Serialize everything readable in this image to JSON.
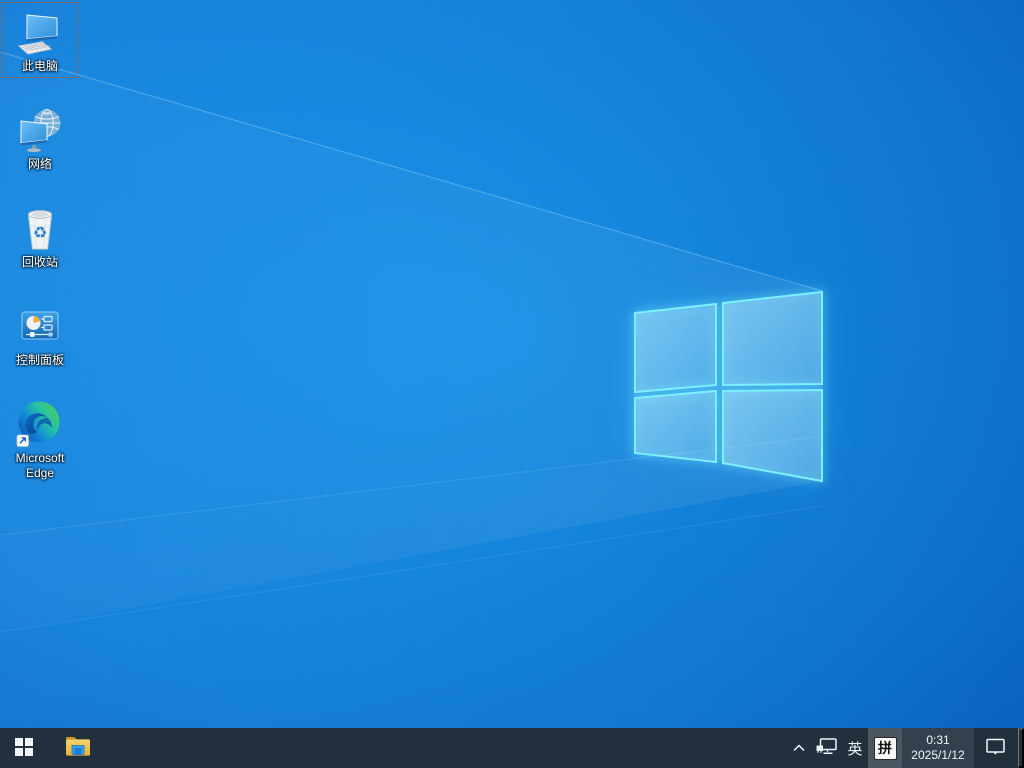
{
  "desktop": {
    "icons": [
      {
        "label": "此电脑",
        "selected": true,
        "icon": "computer-icon"
      },
      {
        "label": "网络",
        "selected": false,
        "icon": "network-globe-icon"
      },
      {
        "label": "回收站",
        "selected": false,
        "icon": "recycle-bin-icon"
      },
      {
        "label": "控制面板",
        "selected": false,
        "icon": "control-panel-icon"
      },
      {
        "label": "Microsoft Edge",
        "selected": false,
        "icon": "edge-icon",
        "shortcut_overlay": true
      }
    ],
    "wallpaper": "windows-10-light-rays-logo"
  },
  "taskbar": {
    "start_icon": "windows-logo-icon",
    "pinned_icons": [
      "file-explorer-icon"
    ],
    "tray": {
      "hidden_icons_icon": "chevron-up-icon",
      "network_icon": "ethernet-icon",
      "language_indicator": "英",
      "ime_mode": "拼",
      "clock": {
        "time": "0:31",
        "date": "2025/1/12"
      },
      "action_center_icon": "notification-bubble-icon",
      "show_desktop": "show-desktop-strip"
    }
  },
  "colors": {
    "taskbar_bg": "#22303e",
    "tray_ime_highlight": "#4a5661",
    "wallpaper_center": "#1598f2",
    "wallpaper_edge": "#0a51b4",
    "logo_stroke": "#7df0ff",
    "selection_dash": "#a85a2d"
  }
}
